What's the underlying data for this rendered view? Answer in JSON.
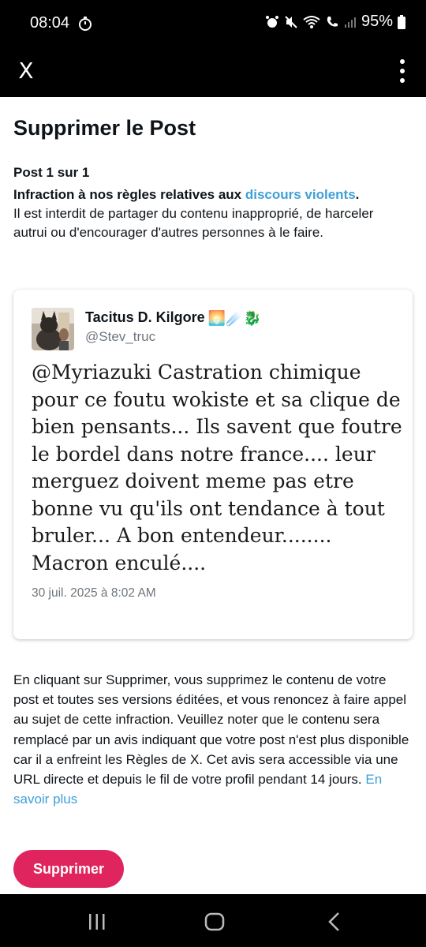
{
  "status_bar": {
    "time": "08:04",
    "battery": "95%"
  },
  "app_bar": {
    "close_label": "X"
  },
  "page": {
    "title": "Supprimer le Post",
    "post_count": "Post 1 sur 1",
    "violation_prefix": "Infraction à nos règles relatives aux ",
    "violation_link": "discours violents",
    "violation_suffix": ".",
    "violation_description": "Il est interdit de partager du contenu inapproprié, de harceler autrui ou d'encourager d'autres personnes à le faire."
  },
  "post": {
    "author_name": "Tacitus D. Kilgore",
    "author_emoji": "🌅☄️🐉",
    "author_handle": "@Stev_truc",
    "text": "@Myriazuki Castration chimique pour ce foutu wokiste et sa clique de bien pensants... Ils savent que foutre le bordel dans notre france.... leur merguez doivent meme pas etre bonne vu qu'ils ont tendance à tout bruler... A bon entendeur........ Macron enculé....",
    "date": "30 juil. 2025 à 8:02 AM"
  },
  "notice": {
    "text": "En cliquant sur Supprimer, vous supprimez le contenu de votre post et toutes ses versions éditées, et vous renoncez à faire appel au sujet de cette infraction. Veuillez noter que le contenu sera remplacé par un avis indiquant que votre post n'est plus disponible car il a enfreint les Règles de X. Cet avis sera accessible via une URL directe et depuis le fil de votre profil pendant 14 jours.",
    "link": "En savoir plus"
  },
  "actions": {
    "delete_label": "Supprimer"
  },
  "colors": {
    "link": "#3f9fd8",
    "delete_button": "#e0245e"
  }
}
